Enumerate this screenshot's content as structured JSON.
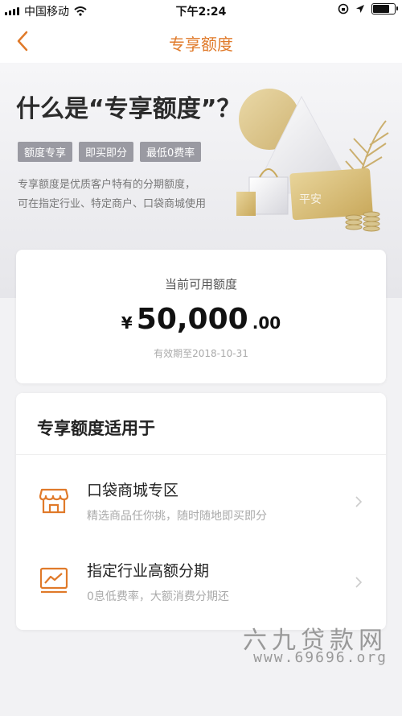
{
  "status_bar": {
    "carrier": "中国移动",
    "time": "下午2:24",
    "icons": [
      "signal-icon",
      "wifi-icon",
      "orientation-lock-icon",
      "location-icon",
      "battery-icon"
    ]
  },
  "nav": {
    "title": "专享额度",
    "back_icon": "chevron-left-icon"
  },
  "hero": {
    "title": "什么是“专享额度”？",
    "tags": [
      "额度专享",
      "即买即分",
      "最低0费率"
    ],
    "desc_line1": "专享额度是优质客户特有的分期额度，",
    "desc_line2": "可在指定行业、特定商户、口袋商城使用",
    "illustration_text": "平安"
  },
  "credit": {
    "label": "当前可用额度",
    "currency": "¥",
    "amount_integer": "50,000",
    "amount_decimal": ".00",
    "expiry": "有效期至2018-10-31"
  },
  "applies": {
    "heading": "专享额度适用于",
    "items": [
      {
        "title": "口袋商城专区",
        "subtitle": "精选商品任你挑，随时随地即买即分",
        "icon": "store-icon"
      },
      {
        "title": "指定行业高额分期",
        "subtitle": "0息低费率，大额消费分期还",
        "icon": "chart-icon"
      }
    ]
  },
  "watermark": {
    "line1": "六九贷款网",
    "line2": "www.69696.org"
  },
  "colors": {
    "accent": "#e07a2a",
    "tag_bg": "#9a9aa2",
    "page_bg": "#f2f2f4"
  }
}
